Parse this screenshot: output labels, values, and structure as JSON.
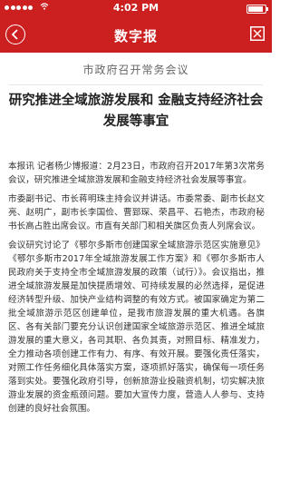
{
  "status_bar": {
    "carrier_icon": "signal-dots-icon",
    "wifi_icon": "wifi-icon",
    "time": "4:02 PM",
    "battery_icon": "battery-icon"
  },
  "nav": {
    "back_icon": "chevron-left-icon",
    "title": "数字报",
    "close_icon": "grid-close-icon",
    "bg_color": "#cc1f1f"
  },
  "article": {
    "subhead": "市政府召开常务会议",
    "headline": "研究推进全域旅游发展和 金融支持经济社会发展等事宜",
    "paragraphs": [
      "本报讯 记者杨少博报道：2月23日，市政府召开2017年第3次常务会议，研究推进全域旅游发展和金融支持经济社会发展等事宜。",
      "市委副书记、市长蒋明珠主持会议并讲话。市委常委、副市长赵文亮、赵明广，副市长李国俭、曹郅琛、荣昌平、石艳杰，市政府秘书长高占胜出席会议。市直有关部门和相关旗区负责人列席会议。",
      "会议研究讨论了《鄂尔多斯市创建国家全域旅游示范区实施意见》《鄂尔多斯市2017年全域旅游发展工作方案》和《鄂尔多斯市人民政府关于支持全市全域旅游发展的政策（试行）》。会议指出，推进全域旅游发展是加快提质增效、可持续发展的必然选择，是促进经济转型升级、加快产业结构调整的有效方式。被国家确定为第二批全域旅游示范区创建单位，是我市旅游发展的重大机遇。各旗区、各有关部门要充分认识创建国家全域旅游示范区、推进全域旅游发展的重大意义，各司其职、各负其责，对照目标、精准发力，全力推动各项创建工作有力、有序、有效开展。要强化责任落实，对照工作任务细化具体落实方案，逐项抓好落实，确保每一项任务落到实处。要强化政府引导，创新旅游业投融资机制，切实解决旅游业发展的资金瓶颈问题。要加大宣传力度，营造人人参与、支持创建的良好社会氛围。"
    ]
  }
}
